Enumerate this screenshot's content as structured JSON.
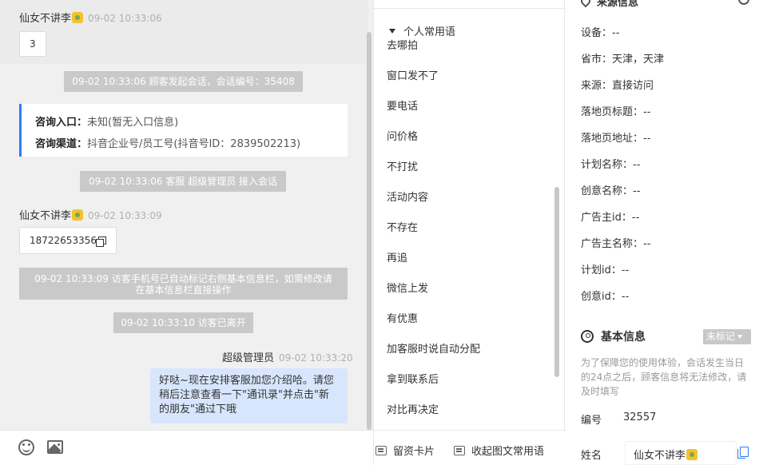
{
  "chat": {
    "msg1": {
      "sender": "仙女不讲李",
      "time": "09-02 10:33:06",
      "text": "3"
    },
    "sys_start": "09-02 10:33:06 顾客发起会话，会话编号：35408",
    "consult": {
      "entry_label": "咨询入口：",
      "entry_value": "未知(暂无入口信息)",
      "channel_label": "咨询渠道：",
      "channel_value": "抖音企业号/员工号(抖音号ID：2839502213)"
    },
    "sys_join": "09-02 10:33:06 客服 超级管理员 接入会话",
    "msg2": {
      "sender": "仙女不讲李",
      "time": "09-02 10:33:09",
      "text": "18722653356"
    },
    "sys_phone_line1": "09-02 10:33:09 访客手机号已自动标记右侧基本信息栏，如需修改请",
    "sys_phone_line2": "在基本信息栏直接操作",
    "sys_left": "09-02 10:33:10 访客已离开",
    "msg3": {
      "sender": "超级管理员",
      "time": "09-02 10:33:20",
      "line1": "好哒~现在安排客服加您介绍哈。请您",
      "line2": "稍后注意查看一下\"通讯录\"并点击\"新",
      "line3": "的朋友\"通过下哦"
    }
  },
  "phrases": {
    "group": "个人常用语",
    "items": [
      "去哪拍",
      "窗口发不了",
      "要电话",
      "问价格",
      "不打扰",
      "活动内容",
      "不存在",
      "再追",
      "微信上发",
      "有优惠",
      "加客服时说自动分配",
      "拿到联系后",
      "对比再决定"
    ],
    "bottom_left": "留资卡片",
    "bottom_right": "收起图文常用语"
  },
  "info": {
    "source_title": "来源信息",
    "rows": [
      {
        "label": "设备：",
        "value": "--"
      },
      {
        "label": "省市：",
        "value": "天津，天津"
      },
      {
        "label": "来源：",
        "value": "直接访问"
      },
      {
        "label": "落地页标题：",
        "value": "--"
      },
      {
        "label": "落地页地址：",
        "value": "--"
      },
      {
        "label": "计划名称：",
        "value": "--"
      },
      {
        "label": "创意名称：",
        "value": "--"
      },
      {
        "label": "广告主id：",
        "value": "--"
      },
      {
        "label": "广告主名称：",
        "value": "--"
      },
      {
        "label": "计划id：",
        "value": "--"
      },
      {
        "label": "创意id：",
        "value": "--"
      }
    ],
    "basic_title": "基本信息",
    "tag": "未标记",
    "note": "为了保障您的使用体验，会话发生当日的24点之后，顾客信息将无法修改，请及时填写",
    "id_label": "编号",
    "id_value": "32557",
    "name_label": "姓名",
    "name_value": "仙女不讲李"
  },
  "colors": {
    "accent": "#2b7cf4",
    "system_bg": "#c9c9c9",
    "agent_bubble": "#d7e6fc"
  }
}
